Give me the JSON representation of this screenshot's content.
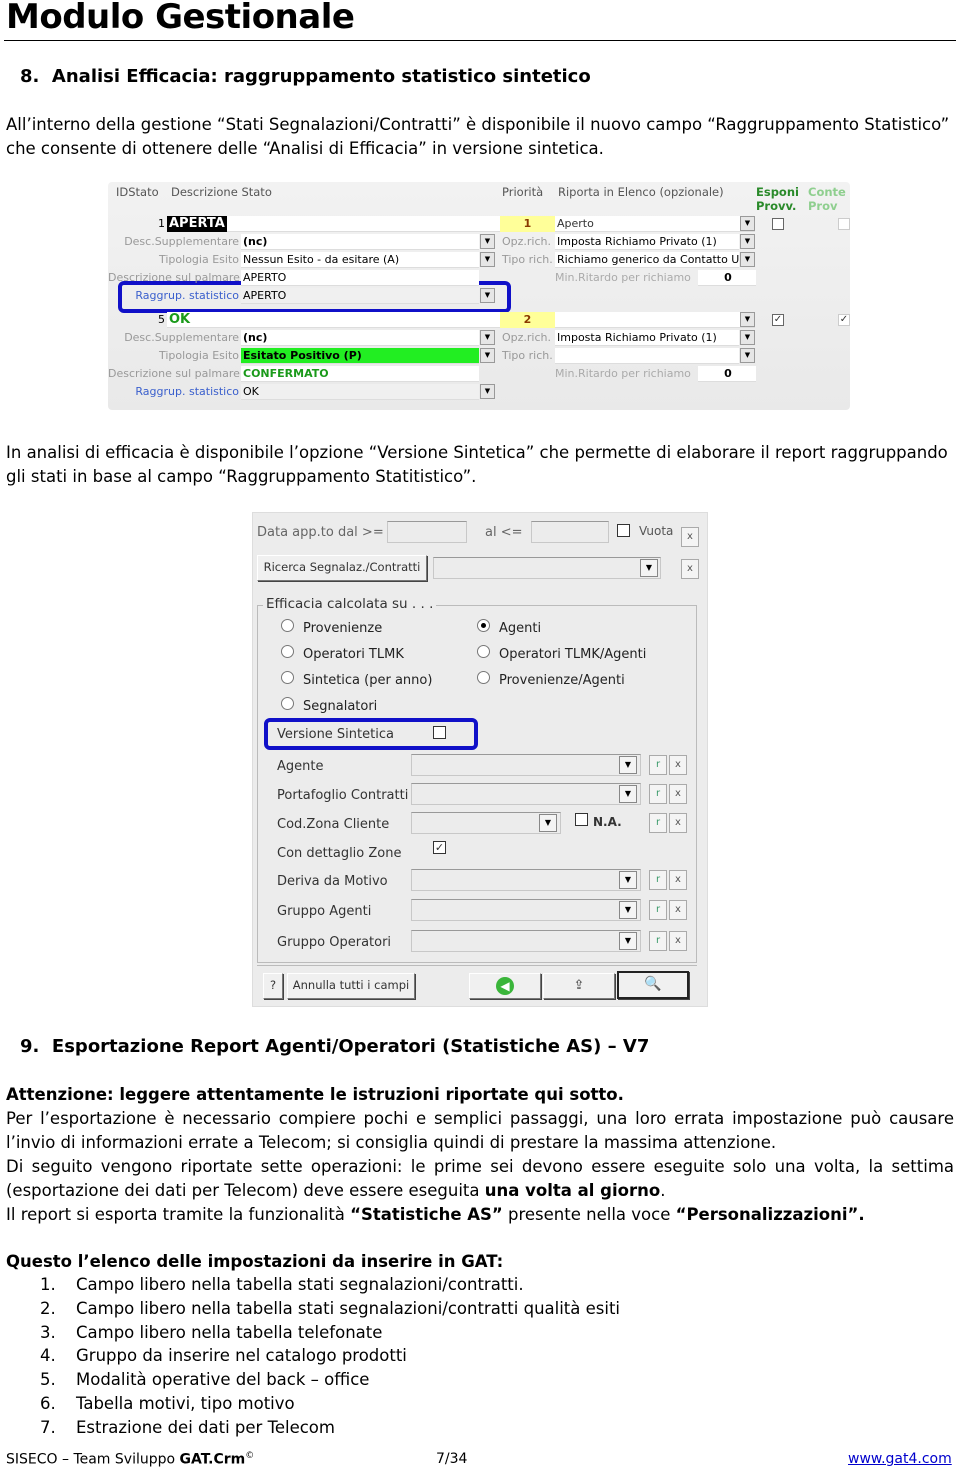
{
  "header": {
    "title": "Modulo Gestionale"
  },
  "section8": {
    "number": "8.",
    "title": "Analisi Efficacia: raggruppamento statistico sintetico",
    "para1": "All’interno della gestione “Stati Segnalazioni/Contratti” è disponibile il nuovo campo “Raggruppamento Statistico” che consente di ottenere delle “Analisi di Efficacia” in versione sintetica.",
    "para2": "In analisi di efficacia è disponibile l’opzione “Versione Sintetica” che permette di elaborare il report raggruppando gli stati in base al campo “Raggruppamento Statitistico”."
  },
  "screenshot1": {
    "headers": {
      "id": "IDStato",
      "desc": "Descrizione Stato",
      "priority": "Priorità",
      "report": "Riporta in Elenco (opzionale)",
      "esponi": "Esponi Provv.",
      "conte": "Conte Prov"
    },
    "labels": {
      "desc_supp": "Desc.Supplementare",
      "tipologia": "Tipologia Esito",
      "palmare": "Descrizione sul palmare",
      "raggrup": "Raggrup. statistico",
      "opz": "Opz.rich.",
      "tipo": "Tipo rich.",
      "min_ritardo": "Min.Ritardo per richiamo"
    },
    "records": [
      {
        "id": "1",
        "name": "APERTA",
        "priority": "1",
        "report": "Aperto",
        "desc_supp": "(nc)",
        "tipologia": "Nessun Esito - da esitare (A)",
        "palmare": "APERTO",
        "raggrup": "APERTO",
        "opz": "Imposta Richiamo Privato (1)",
        "tipo": "Richiamo generico da Contatto U",
        "min_ritardo": "0",
        "esponi": false
      },
      {
        "id": "5",
        "name": "OK",
        "priority": "2",
        "report": "",
        "desc_supp": "(nc)",
        "tipologia": "Esitato Positivo (P)",
        "palmare": "CONFERMATO",
        "raggrup": "OK",
        "opz": "Imposta Richiamo Privato (1)",
        "tipo": "",
        "min_ritardo": "0",
        "esponi": true
      }
    ]
  },
  "screenshot2": {
    "date_from_label": "Data app.to dal >=",
    "date_to_label": "al <=",
    "empty_label": "Vuota",
    "search_button": "Ricerca Segnalaz./Contratti",
    "group_label": "Efficacia calcolata su . . .",
    "radios": [
      {
        "label": "Provenienze",
        "checked": false
      },
      {
        "label": "Operatori TLMK",
        "checked": false
      },
      {
        "label": "Sintetica (per anno)",
        "checked": false
      },
      {
        "label": "Segnalatori",
        "checked": false
      },
      {
        "label": "Agenti",
        "checked": true
      },
      {
        "label": "Operatori TLMK/Agenti",
        "checked": false
      },
      {
        "label": "Provenienze/Agenti",
        "checked": false
      }
    ],
    "versione_sintetica": {
      "label": "Versione Sintetica",
      "checked": false
    },
    "filters": {
      "agente": "Agente",
      "portafoglio": "Portafoglio Contratti",
      "zona": "Cod.Zona Cliente",
      "na": "N.A.",
      "dettaglio_zone": "Con dettaglio Zone",
      "motivo": "Deriva da Motivo",
      "gruppo_agenti": "Gruppo Agenti",
      "gruppo_operatori": "Gruppo Operatori"
    },
    "dettaglio_zone_checked": true,
    "small_r": "r",
    "small_x": "x",
    "help": "?",
    "reset_button": "Annulla tutti i campi"
  },
  "section9": {
    "number": "9.",
    "title": "Esportazione Report Agenti/Operatori (Statistiche AS) – V7",
    "warning": "Attenzione: leggere attentamente le istruzioni riportate qui sotto.",
    "para1": "Per l’esportazione è necessario compiere pochi e semplici passaggi, una loro errata impostazione può causare l’invio di informazioni errate a Telecom; si consiglia quindi di prestare la massima attenzione.",
    "para2a": "Di seguito vengono riportate sette operazioni: le prime sei devono essere eseguite solo una volta, la settima (esportazione dei dati per Telecom) deve essere eseguita ",
    "para2b": "una volta al giorno",
    "para2c": ".",
    "para3a": "Il report si esporta tramite la funzionalità ",
    "para3b": "“Statistiche AS”",
    "para3c": " presente nella voce ",
    "para3d": "“Personalizzazioni”.",
    "list_title": "Questo l’elenco delle impostazioni da inserire in GAT:",
    "items": [
      {
        "n": "1.",
        "text": "Campo libero nella tabella stati segnalazioni/contratti."
      },
      {
        "n": "2.",
        "text": "Campo libero nella tabella stati segnalazioni/contratti qualità esiti"
      },
      {
        "n": "3.",
        "text": "Campo libero nella tabella telefonate"
      },
      {
        "n": "4.",
        "text": "Gruppo da inserire nel catalogo prodotti"
      },
      {
        "n": "5.",
        "text": "Modalità operative del back – office"
      },
      {
        "n": "6.",
        "text": "Tabella motivi, tipo motivo"
      },
      {
        "n": "7.",
        "text": "Estrazione dei dati per Telecom"
      }
    ]
  },
  "footer": {
    "left": "SISECO – Team Sviluppo ",
    "brand": "GAT.Crm",
    "copyright": "©",
    "page": "7/34",
    "link": "www.gat4.com"
  }
}
